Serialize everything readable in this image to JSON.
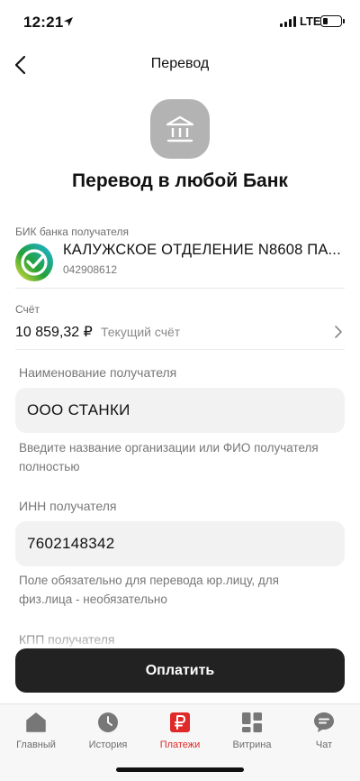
{
  "status_bar": {
    "time": "12:21",
    "network": "LTE"
  },
  "nav": {
    "title": "Перевод"
  },
  "header": {
    "title": "Перевод в любой Банк",
    "icon": "bank-building-icon"
  },
  "bik": {
    "label": "БИК банка получателя",
    "bank_name": "КАЛУЖСКОЕ ОТДЕЛЕНИЕ N8608 ПА...",
    "code": "042908612"
  },
  "account": {
    "label": "Счёт",
    "amount": "10 859,32 ₽",
    "type": "Текущий счёт"
  },
  "recipient_name": {
    "label": "Наименование получателя",
    "value": "ООО СТАНКИ",
    "hint": "Введите название организации или ФИО получателя полностью"
  },
  "inn": {
    "label": "ИНН получателя",
    "value": "7602148342",
    "hint": "Поле обязательно для перевода юр.лицу, для физ.лица - необязательно"
  },
  "kpp": {
    "label": "КПП получателя"
  },
  "pay_button": {
    "label": "Оплатить"
  },
  "tabs": [
    {
      "label": "Главный",
      "icon": "home-icon",
      "active": false
    },
    {
      "label": "История",
      "icon": "clock-icon",
      "active": false
    },
    {
      "label": "Платежи",
      "icon": "ruble-icon",
      "active": true
    },
    {
      "label": "Витрина",
      "icon": "grid-icon",
      "active": false
    },
    {
      "label": "Чат",
      "icon": "chat-icon",
      "active": false
    }
  ],
  "colors": {
    "accent": "#e02a2a",
    "pay_button": "#222222",
    "bank_green": "#21a038"
  }
}
